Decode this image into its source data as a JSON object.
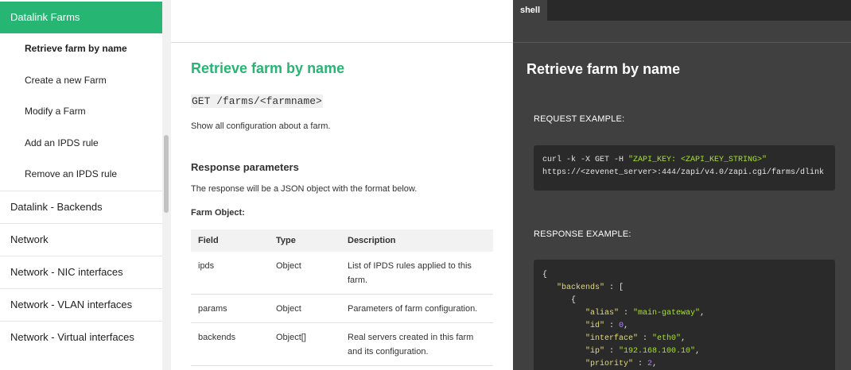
{
  "sidebar": {
    "active_section": "Datalink Farms",
    "sub_items": [
      {
        "label": "Retrieve farm by name",
        "current": true
      },
      {
        "label": "Create a new Farm",
        "current": false
      },
      {
        "label": "Modify a Farm",
        "current": false
      },
      {
        "label": "Add an IPDS rule",
        "current": false
      },
      {
        "label": "Remove an IPDS rule",
        "current": false
      }
    ],
    "items": [
      "Datalink - Backends",
      "Network",
      "Network - NIC interfaces",
      "Network - VLAN interfaces",
      "Network - Virtual interfaces"
    ]
  },
  "content": {
    "title": "Retrieve farm by name",
    "endpoint": "GET /farms/<farmname>",
    "description": "Show all configuration about a farm.",
    "response_title": "Response parameters",
    "response_description": "The response will be a JSON object with the format below.",
    "object_label": "Farm Object:",
    "table": {
      "headers": [
        "Field",
        "Type",
        "Description"
      ],
      "rows": [
        {
          "field": "ipds",
          "type": "Object",
          "description": "List of IPDS rules applied to this farm."
        },
        {
          "field": "params",
          "type": "Object",
          "description": "Parameters of farm configuration."
        },
        {
          "field": "backends",
          "type": "Object[]",
          "description": "Real servers created in this farm and its configuration."
        }
      ]
    }
  },
  "code_panel": {
    "tab": "shell",
    "title": "Retrieve farm by name",
    "request_label": "REQUEST EXAMPLE:",
    "request": {
      "cmd": "curl -k -X GET -H ",
      "header": "\"ZAPI_KEY: <ZAPI_KEY_STRING>\"",
      "url": "https://<zevenet_server>:444/zapi/v4.0/zapi.cgi/farms/dlink"
    },
    "response_label": "RESPONSE EXAMPLE:",
    "response": {
      "open_brace": "{",
      "backends_key": "\"backends\"",
      "backends_open": " : [",
      "obj_open": "{",
      "alias_key": "\"alias\"",
      "alias_val": "\"main-gateway\"",
      "id_key": "\"id\"",
      "id_val": "0",
      "iface_key": "\"interface\"",
      "iface_val": "\"eth0\"",
      "ip_key": "\"ip\"",
      "ip_val": "\"192.168.100.10\"",
      "priority_key": "\"priority\"",
      "priority_val": "2"
    }
  },
  "colors": {
    "accent": "#27b574",
    "dark_panel": "#404040",
    "code_bg": "#2a2a2a"
  }
}
